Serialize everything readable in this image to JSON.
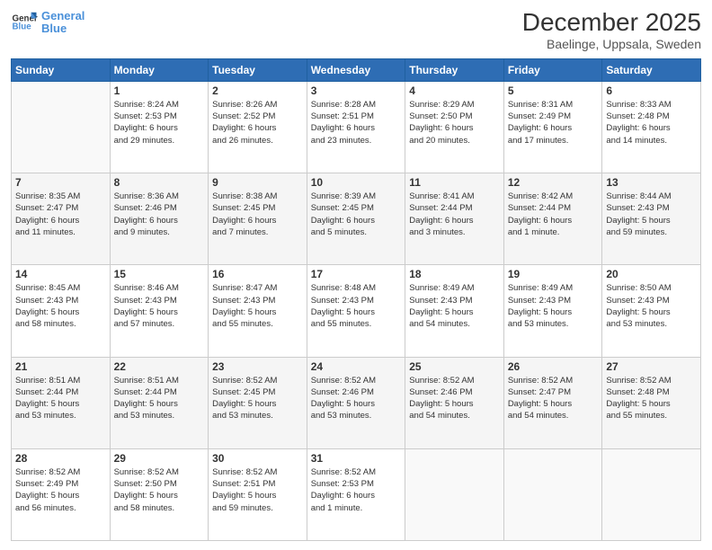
{
  "header": {
    "logo_line1": "General",
    "logo_line2": "Blue",
    "title": "December 2025",
    "subtitle": "Baelinge, Uppsala, Sweden"
  },
  "days_of_week": [
    "Sunday",
    "Monday",
    "Tuesday",
    "Wednesday",
    "Thursday",
    "Friday",
    "Saturday"
  ],
  "weeks": [
    [
      {
        "day": "",
        "info": ""
      },
      {
        "day": "1",
        "info": "Sunrise: 8:24 AM\nSunset: 2:53 PM\nDaylight: 6 hours\nand 29 minutes."
      },
      {
        "day": "2",
        "info": "Sunrise: 8:26 AM\nSunset: 2:52 PM\nDaylight: 6 hours\nand 26 minutes."
      },
      {
        "day": "3",
        "info": "Sunrise: 8:28 AM\nSunset: 2:51 PM\nDaylight: 6 hours\nand 23 minutes."
      },
      {
        "day": "4",
        "info": "Sunrise: 8:29 AM\nSunset: 2:50 PM\nDaylight: 6 hours\nand 20 minutes."
      },
      {
        "day": "5",
        "info": "Sunrise: 8:31 AM\nSunset: 2:49 PM\nDaylight: 6 hours\nand 17 minutes."
      },
      {
        "day": "6",
        "info": "Sunrise: 8:33 AM\nSunset: 2:48 PM\nDaylight: 6 hours\nand 14 minutes."
      }
    ],
    [
      {
        "day": "7",
        "info": "Sunrise: 8:35 AM\nSunset: 2:47 PM\nDaylight: 6 hours\nand 11 minutes."
      },
      {
        "day": "8",
        "info": "Sunrise: 8:36 AM\nSunset: 2:46 PM\nDaylight: 6 hours\nand 9 minutes."
      },
      {
        "day": "9",
        "info": "Sunrise: 8:38 AM\nSunset: 2:45 PM\nDaylight: 6 hours\nand 7 minutes."
      },
      {
        "day": "10",
        "info": "Sunrise: 8:39 AM\nSunset: 2:45 PM\nDaylight: 6 hours\nand 5 minutes."
      },
      {
        "day": "11",
        "info": "Sunrise: 8:41 AM\nSunset: 2:44 PM\nDaylight: 6 hours\nand 3 minutes."
      },
      {
        "day": "12",
        "info": "Sunrise: 8:42 AM\nSunset: 2:44 PM\nDaylight: 6 hours\nand 1 minute."
      },
      {
        "day": "13",
        "info": "Sunrise: 8:44 AM\nSunset: 2:43 PM\nDaylight: 5 hours\nand 59 minutes."
      }
    ],
    [
      {
        "day": "14",
        "info": "Sunrise: 8:45 AM\nSunset: 2:43 PM\nDaylight: 5 hours\nand 58 minutes."
      },
      {
        "day": "15",
        "info": "Sunrise: 8:46 AM\nSunset: 2:43 PM\nDaylight: 5 hours\nand 57 minutes."
      },
      {
        "day": "16",
        "info": "Sunrise: 8:47 AM\nSunset: 2:43 PM\nDaylight: 5 hours\nand 55 minutes."
      },
      {
        "day": "17",
        "info": "Sunrise: 8:48 AM\nSunset: 2:43 PM\nDaylight: 5 hours\nand 55 minutes."
      },
      {
        "day": "18",
        "info": "Sunrise: 8:49 AM\nSunset: 2:43 PM\nDaylight: 5 hours\nand 54 minutes."
      },
      {
        "day": "19",
        "info": "Sunrise: 8:49 AM\nSunset: 2:43 PM\nDaylight: 5 hours\nand 53 minutes."
      },
      {
        "day": "20",
        "info": "Sunrise: 8:50 AM\nSunset: 2:43 PM\nDaylight: 5 hours\nand 53 minutes."
      }
    ],
    [
      {
        "day": "21",
        "info": "Sunrise: 8:51 AM\nSunset: 2:44 PM\nDaylight: 5 hours\nand 53 minutes."
      },
      {
        "day": "22",
        "info": "Sunrise: 8:51 AM\nSunset: 2:44 PM\nDaylight: 5 hours\nand 53 minutes."
      },
      {
        "day": "23",
        "info": "Sunrise: 8:52 AM\nSunset: 2:45 PM\nDaylight: 5 hours\nand 53 minutes."
      },
      {
        "day": "24",
        "info": "Sunrise: 8:52 AM\nSunset: 2:46 PM\nDaylight: 5 hours\nand 53 minutes."
      },
      {
        "day": "25",
        "info": "Sunrise: 8:52 AM\nSunset: 2:46 PM\nDaylight: 5 hours\nand 54 minutes."
      },
      {
        "day": "26",
        "info": "Sunrise: 8:52 AM\nSunset: 2:47 PM\nDaylight: 5 hours\nand 54 minutes."
      },
      {
        "day": "27",
        "info": "Sunrise: 8:52 AM\nSunset: 2:48 PM\nDaylight: 5 hours\nand 55 minutes."
      }
    ],
    [
      {
        "day": "28",
        "info": "Sunrise: 8:52 AM\nSunset: 2:49 PM\nDaylight: 5 hours\nand 56 minutes."
      },
      {
        "day": "29",
        "info": "Sunrise: 8:52 AM\nSunset: 2:50 PM\nDaylight: 5 hours\nand 58 minutes."
      },
      {
        "day": "30",
        "info": "Sunrise: 8:52 AM\nSunset: 2:51 PM\nDaylight: 5 hours\nand 59 minutes."
      },
      {
        "day": "31",
        "info": "Sunrise: 8:52 AM\nSunset: 2:53 PM\nDaylight: 6 hours\nand 1 minute."
      },
      {
        "day": "",
        "info": ""
      },
      {
        "day": "",
        "info": ""
      },
      {
        "day": "",
        "info": ""
      }
    ]
  ]
}
